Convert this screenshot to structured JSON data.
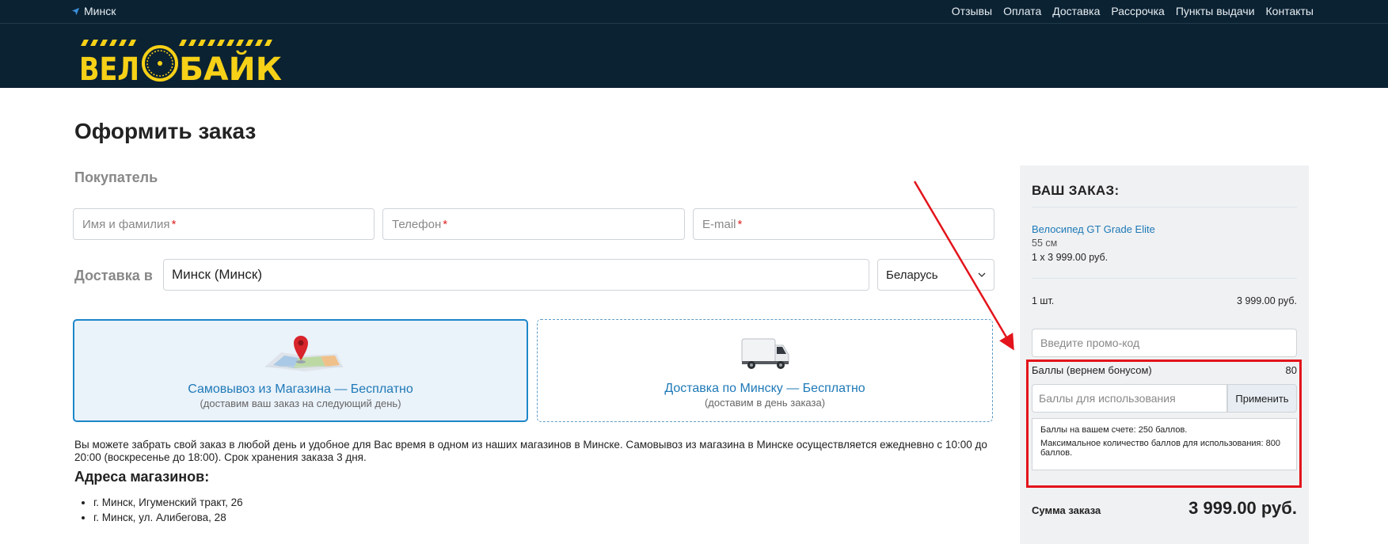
{
  "topbar": {
    "city": "Минск",
    "nav": [
      "Отзывы",
      "Оплата",
      "Доставка",
      "Рассрочка",
      "Пункты выдачи",
      "Контакты"
    ]
  },
  "header": {
    "logo_text": "ВЕЛОБАЙК"
  },
  "main": {
    "title": "Оформить заказ",
    "buyer_heading": "Покупатель",
    "fields": {
      "name_placeholder": "Имя и фамилия",
      "phone_placeholder": "Телефон",
      "email_placeholder": "E-mail",
      "required_mark": "*"
    },
    "delivery_label": "Доставка в",
    "city_value": "Минск (Минск)",
    "country_value": "Беларусь",
    "options": [
      {
        "title": "Самовывоз из Магазина — Бесплатно",
        "subtitle": "(доставим ваш заказ на следующий день)",
        "selected": true
      },
      {
        "title": "Доставка по Минску — Бесплатно",
        "subtitle": "(доставим в день заказа)",
        "selected": false
      }
    ],
    "pickup_text": "Вы можете забрать свой заказ в любой день и удобное для Вас время в одном из наших магазинов в Минске. Самовывоз из магазина в Минске осуществляется ежедневно с 10:00 до 20:00 (воскресенье до 18:00). Срок хранения заказа 3 дня.",
    "addresses_heading": "Адреса магазинов:",
    "addresses": [
      "г. Минск, Игуменский тракт, 26",
      "г. Минск, ул. Алибегова, 28"
    ]
  },
  "order": {
    "title": "ВАШ ЗАКАЗ:",
    "item_name": "Велосипед GT Grade Elite",
    "item_size": "55 см",
    "item_qty_price": "1 x 3 999.00 руб.",
    "count": "1 шт.",
    "count_total": "3 999.00 руб.",
    "promo_placeholder": "Введите промо-код",
    "bonus_label": "Баллы (вернем бонусом)",
    "bonus_value": "80",
    "bonus_placeholder": "Баллы для использования",
    "apply_label": "Применить",
    "bonus_info_1": "Баллы на вашем счете: 250 баллов.",
    "bonus_info_2": "Максимальное количество баллов для использования: 800 баллов.",
    "sum_label": "Сумма заказа",
    "sum_value": "3 999.00 руб."
  },
  "colors": {
    "header_bg": "#0b2233",
    "logo_yellow": "#f7d117",
    "link_blue": "#1e79b7",
    "annotation_red": "#e3141b"
  }
}
